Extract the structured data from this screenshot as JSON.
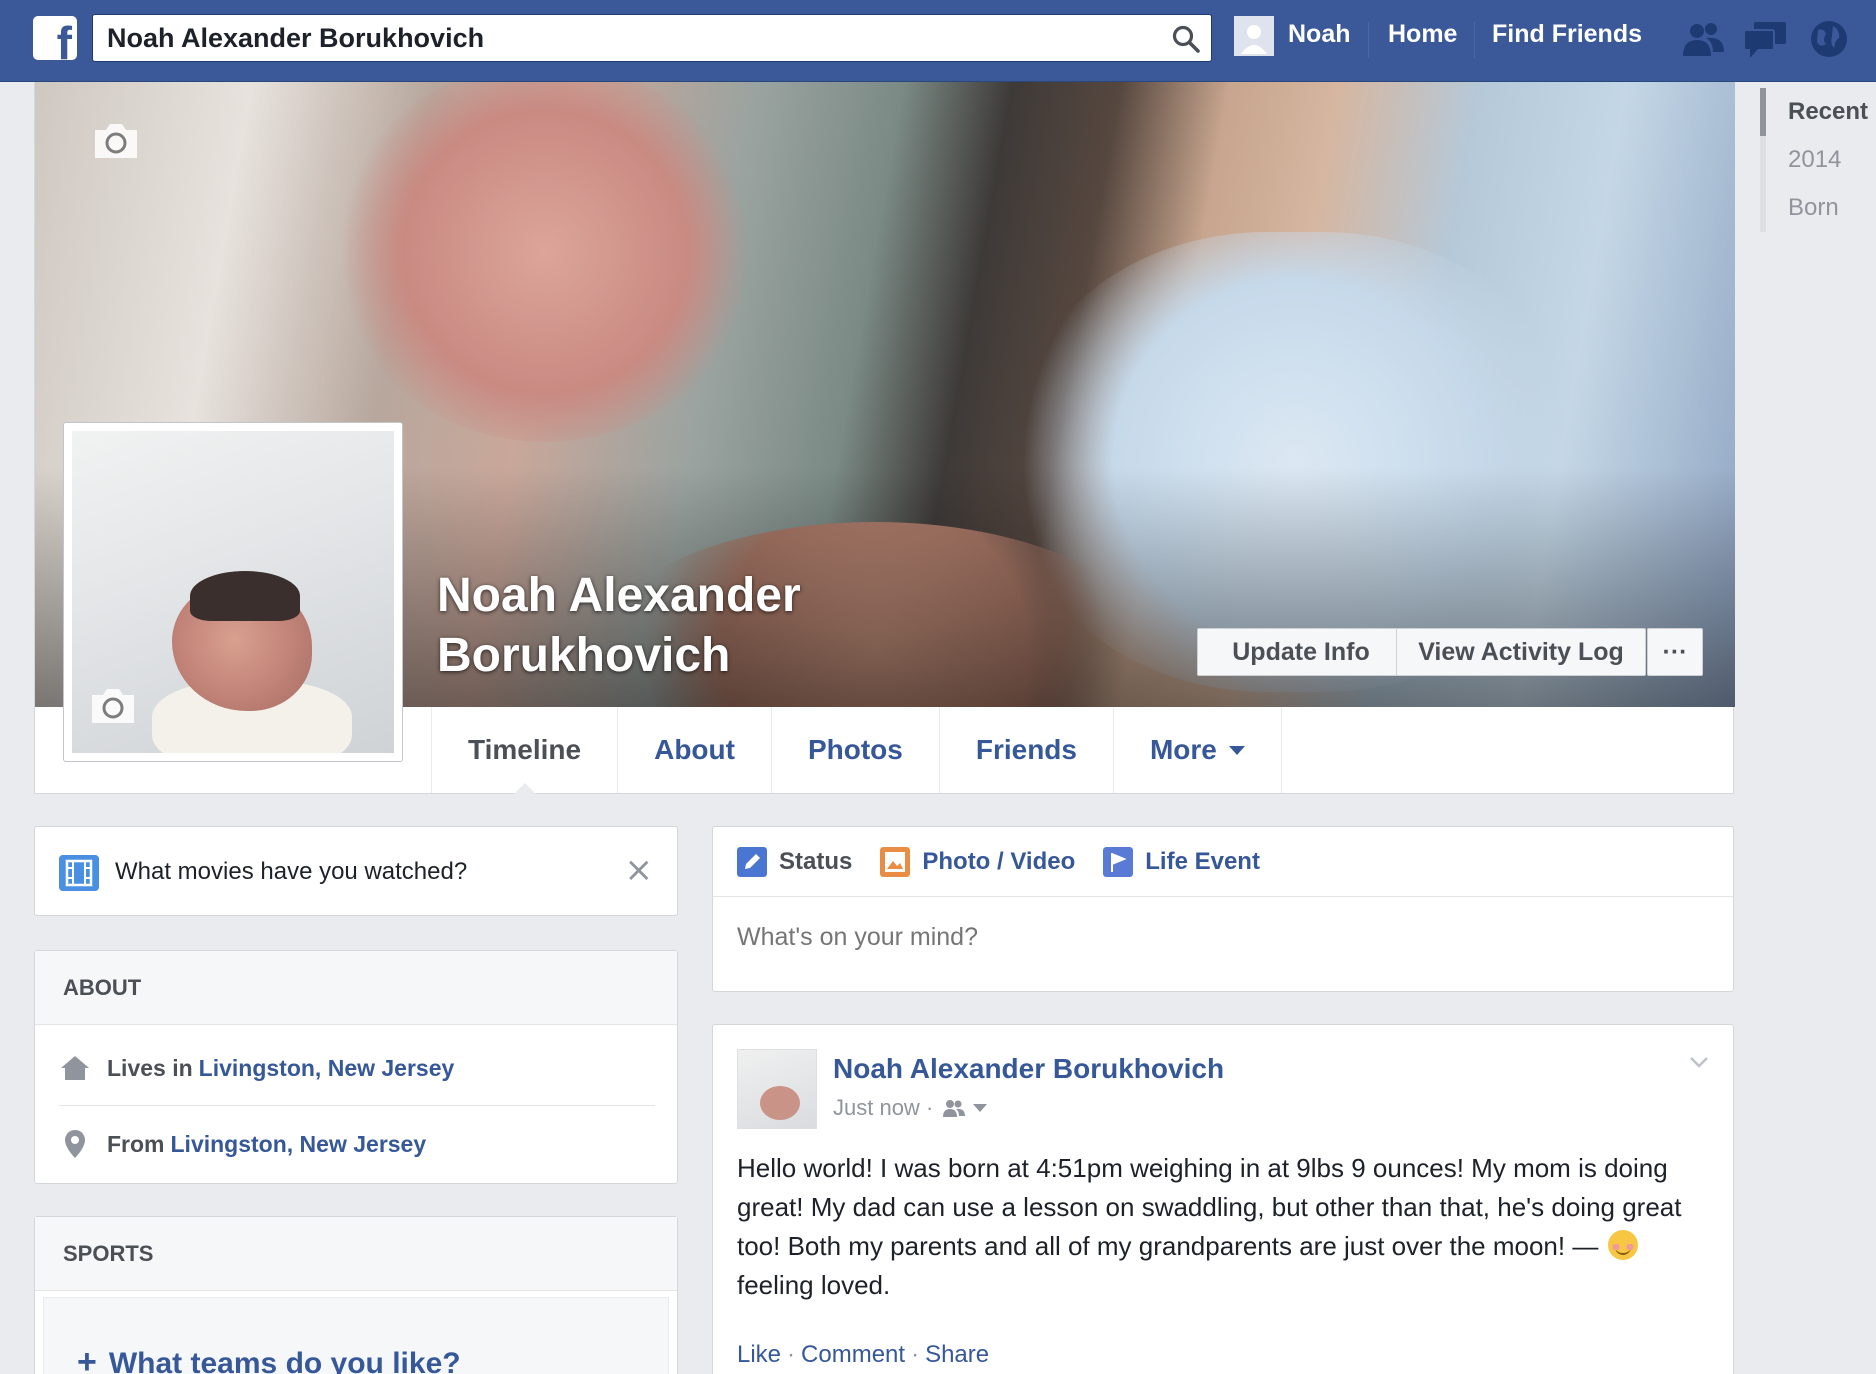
{
  "topbar": {
    "logo": "f",
    "search_value": "Noah Alexander Borukhovich",
    "user_name": "Noah",
    "home": "Home",
    "find_friends": "Find Friends",
    "icons": [
      "friend-requests-icon",
      "messages-icon",
      "notifications-globe-icon"
    ]
  },
  "profile": {
    "name": "Noah Alexander Borukhovich",
    "update_info": "Update Info",
    "view_activity_log": "View Activity Log",
    "more_options": "···"
  },
  "tabs": [
    {
      "label": "Timeline"
    },
    {
      "label": "About"
    },
    {
      "label": "Photos"
    },
    {
      "label": "Friends"
    },
    {
      "label": "More"
    }
  ],
  "scrubber": [
    "Recent",
    "2014",
    "Born"
  ],
  "prompt": {
    "text": "What movies have you watched?",
    "close": "×"
  },
  "about": {
    "heading": "ABOUT",
    "lives_prefix": "Lives in",
    "lives_link": "Livingston, New Jersey",
    "from_prefix": "From",
    "from_link": "Livingston, New Jersey"
  },
  "sports": {
    "heading": "SPORTS",
    "teams_link": "What teams do you like?"
  },
  "composer": {
    "status": "Status",
    "photo_video": "Photo / Video",
    "life_event": "Life Event",
    "placeholder": "What's on your mind?"
  },
  "post": {
    "author": "Noah Alexander Borukhovich",
    "time": "Just now",
    "text": "Hello world! I was born at 4:51pm weighing in at 9lbs 9 ounces! My mom is doing great! My dad can use a lesson on swaddling, but other than that, he's doing great too! Both my parents and all of my grandparents are just over the moon! —",
    "feeling": "feeling loved.",
    "like": "Like",
    "comment": "Comment",
    "share": "Share"
  },
  "colors": {
    "brand": "#3b5998",
    "link": "#365899",
    "background": "#e9ebee"
  }
}
